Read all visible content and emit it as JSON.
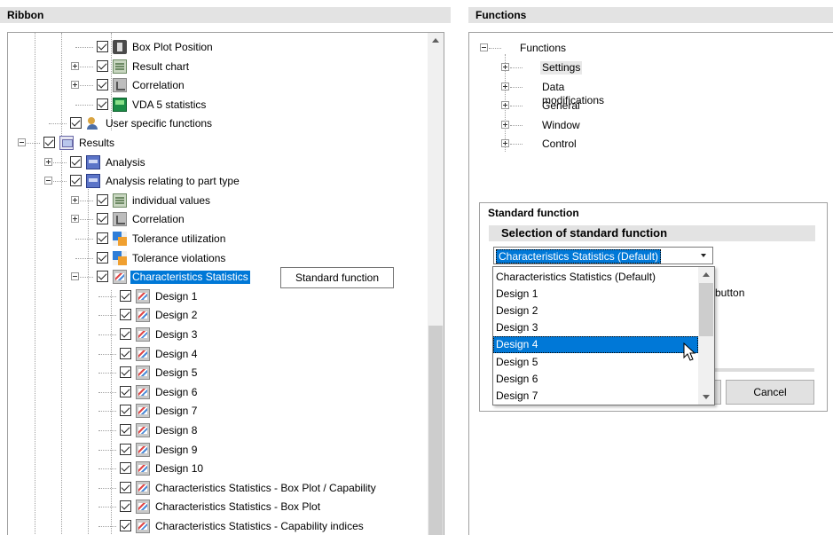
{
  "ribbon": {
    "title": "Ribbon",
    "tree": [
      {
        "label": "Box Plot Position",
        "icon": "box-plot-icon",
        "expander": "none",
        "level": 3,
        "selected": false
      },
      {
        "label": "Result chart",
        "icon": "result-chart-icon",
        "expander": "plus",
        "level": 3,
        "selected": false
      },
      {
        "label": "Correlation",
        "icon": "correlation-icon",
        "expander": "plus",
        "level": 3,
        "selected": false
      },
      {
        "label": "VDA 5 statistics",
        "icon": "vda-icon",
        "expander": "none",
        "level": 3,
        "selected": false
      },
      {
        "label": "User specific functions",
        "icon": "user-icon",
        "expander": "none",
        "level": 2,
        "selected": false
      },
      {
        "label": "Results",
        "icon": "results-folder-icon",
        "expander": "minus",
        "level": 1,
        "selected": false
      },
      {
        "label": "Analysis",
        "icon": "analysis-icon",
        "expander": "plus",
        "level": 2,
        "selected": false
      },
      {
        "label": "Analysis relating to part type",
        "icon": "analysis-icon",
        "expander": "minus",
        "level": 2,
        "selected": false
      },
      {
        "label": "individual values",
        "icon": "individual-values-icon",
        "expander": "plus",
        "level": 3,
        "selected": false
      },
      {
        "label": "Correlation",
        "icon": "correlation-icon",
        "expander": "plus",
        "level": 3,
        "selected": false
      },
      {
        "label": "Tolerance utilization",
        "icon": "tolerance-icon",
        "expander": "none",
        "level": 3,
        "selected": false
      },
      {
        "label": "Tolerance violations",
        "icon": "tolerance-icon",
        "expander": "none",
        "level": 3,
        "selected": false
      },
      {
        "label": "Characteristics Statistics",
        "icon": "statistics-icon",
        "expander": "minus",
        "level": 3,
        "selected": true
      },
      {
        "label": "Design 1",
        "icon": "statistics-icon",
        "expander": "none",
        "level": 4,
        "selected": false
      },
      {
        "label": "Design 2",
        "icon": "statistics-icon",
        "expander": "none",
        "level": 4,
        "selected": false
      },
      {
        "label": "Design 3",
        "icon": "statistics-icon",
        "expander": "none",
        "level": 4,
        "selected": false
      },
      {
        "label": "Design 4",
        "icon": "statistics-icon",
        "expander": "none",
        "level": 4,
        "selected": false
      },
      {
        "label": "Design 5",
        "icon": "statistics-icon",
        "expander": "none",
        "level": 4,
        "selected": false
      },
      {
        "label": "Design 6",
        "icon": "statistics-icon",
        "expander": "none",
        "level": 4,
        "selected": false
      },
      {
        "label": "Design 7",
        "icon": "statistics-icon",
        "expander": "none",
        "level": 4,
        "selected": false
      },
      {
        "label": "Design 8",
        "icon": "statistics-icon",
        "expander": "none",
        "level": 4,
        "selected": false
      },
      {
        "label": "Design 9",
        "icon": "statistics-icon",
        "expander": "none",
        "level": 4,
        "selected": false
      },
      {
        "label": "Design 10",
        "icon": "statistics-icon",
        "expander": "none",
        "level": 4,
        "selected": false
      },
      {
        "label": "Characteristics Statistics - Box Plot / Capability",
        "icon": "statistics-icon",
        "expander": "none",
        "level": 4,
        "selected": false
      },
      {
        "label": "Characteristics Statistics - Box Plot",
        "icon": "statistics-icon",
        "expander": "none",
        "level": 4,
        "selected": false
      },
      {
        "label": "Characteristics Statistics - Capability indices",
        "icon": "statistics-icon",
        "expander": "none",
        "level": 4,
        "selected": false
      }
    ],
    "tooltip": "Standard function"
  },
  "functions": {
    "title": "Functions",
    "root": "Functions",
    "children": [
      "Settings",
      "Data modifications",
      "General",
      "Window",
      "Control"
    ],
    "highlighted": "Settings"
  },
  "standard_function": {
    "group_title": "Standard function",
    "section_title": "Selection of standard function",
    "selected_value": "Characteristics Statistics (Default)",
    "options": [
      "Characteristics Statistics (Default)",
      "Design 1",
      "Design 2",
      "Design 3",
      "Design 4",
      "Design 5",
      "Design 6",
      "Design 7"
    ],
    "hovered_option": "Design 4",
    "partial_text": "e button",
    "cancel_label": "Cancel"
  },
  "colors": {
    "selection": "#0078d7",
    "header_bg": "#e3e3e3"
  }
}
